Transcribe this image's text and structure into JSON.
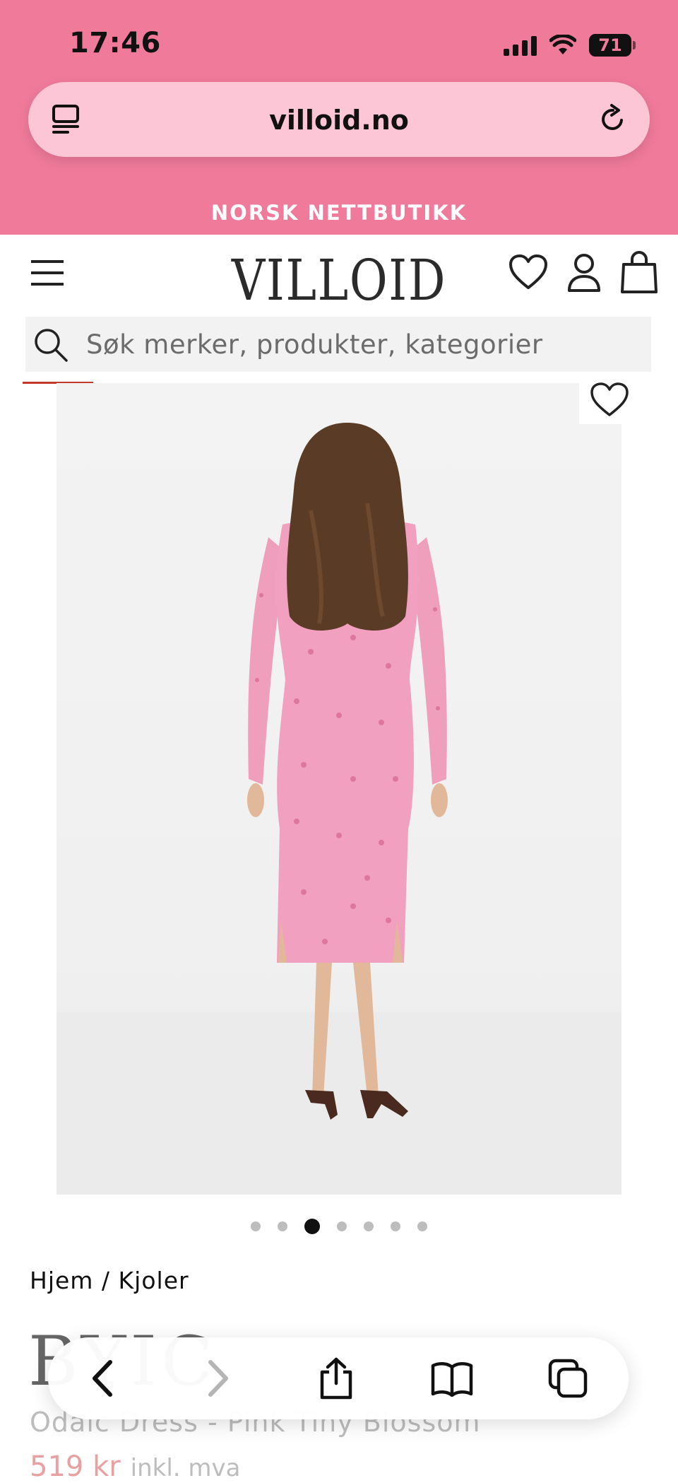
{
  "status_bar": {
    "time": "17:46",
    "battery": "71"
  },
  "browser": {
    "url": "villoid.no"
  },
  "promo_banner": {
    "text": "NORSK NETTBUTIKK"
  },
  "header": {
    "logo": "VILLOID",
    "icons": [
      "menu-icon",
      "heart-icon",
      "user-icon",
      "bag-icon"
    ]
  },
  "search": {
    "placeholder": "Søk merker, produkter, kategorier"
  },
  "gallery": {
    "image_count": 7,
    "active_index": 2
  },
  "breadcrumb": "Hjem / Kjoler",
  "product": {
    "brand": "BYIC",
    "name": "Odaic Dress - Pink Tiny Blossom",
    "price": "519 kr",
    "price_note": "inkl. mva"
  },
  "toolbar": {
    "icons": [
      "back-icon",
      "forward-icon",
      "share-icon",
      "bookmarks-icon",
      "tabs-icon"
    ]
  },
  "colors": {
    "chrome_pink": "#f07a9a",
    "url_bar": "#fcc6d6",
    "dress_pink": "#f2a0bf",
    "accent_red": "#c0392b"
  }
}
